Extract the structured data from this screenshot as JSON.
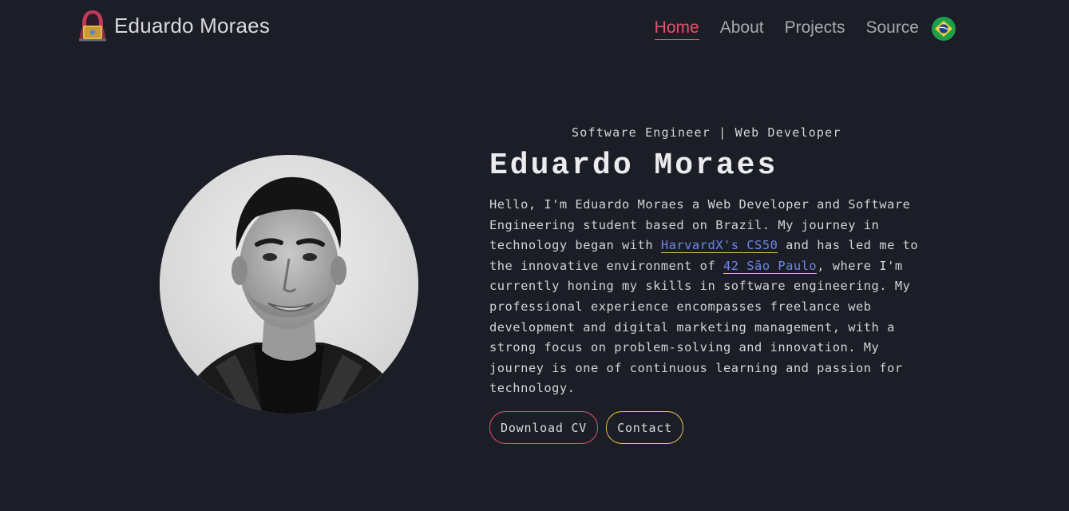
{
  "header": {
    "brand_name": "Eduardo Moraes",
    "logo_icon": "hooded-hacker-laptop-icon",
    "nav": [
      {
        "label": "Home",
        "active": true
      },
      {
        "label": "About",
        "active": false
      },
      {
        "label": "Projects",
        "active": false
      },
      {
        "label": "Source",
        "active": false
      }
    ],
    "language_icon": "brazil-flag-icon"
  },
  "hero": {
    "photo_icon": "profile-photo",
    "subtitle": "Software Engineer | Web Developer",
    "title": "Eduardo Moraes",
    "bio": {
      "part1": "Hello, I'm Eduardo Moraes a Web Developer and Software Engineering student based on Brazil. My journey in technology began with ",
      "link1": "HarvardX's CS50",
      "part2": " and has led me to the innovative environment of ",
      "link2": "42 São Paulo",
      "part3": ", where I'm currently honing my skills in software engineering. My professional experience encompasses freelance web development and digital marketing management, with a strong focus on problem-solving and innovation. My journey is one of continuous learning and passion for technology."
    },
    "buttons": {
      "download_cv": "Download CV",
      "contact": "Contact"
    }
  },
  "colors": {
    "background": "#1b1d27",
    "accent_red": "#e8506b",
    "accent_yellow": "#e6c55a",
    "link_blue": "#6d87e6"
  }
}
